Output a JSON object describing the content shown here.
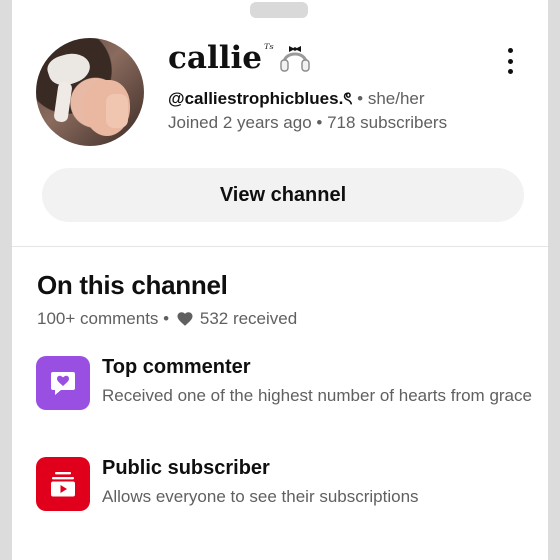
{
  "channel": {
    "name": "callie",
    "name_superscript": "ᵀˢ",
    "handle": "@calliestrophicblues.ৎ",
    "pronouns": "she/her",
    "joined": "Joined 2 years ago",
    "subscribers": "718 subscribers",
    "separator": "•",
    "view_channel_label": "View channel"
  },
  "on_this_channel": {
    "title": "On this channel",
    "comments": "100+ comments",
    "hearts_received": "532 received",
    "badges": [
      {
        "title": "Top commenter",
        "description": "Received one of the highest number of hearts from grace",
        "icon": "heart-comment-icon",
        "color": "#9a4fe3"
      },
      {
        "title": "Public subscriber",
        "description": "Allows everyone to see their subscriptions",
        "icon": "subscriptions-icon",
        "color": "#e1001c"
      }
    ]
  },
  "icons": {
    "menu": "more-vert-icon",
    "name_decoration": "headphones-bow-icon"
  }
}
